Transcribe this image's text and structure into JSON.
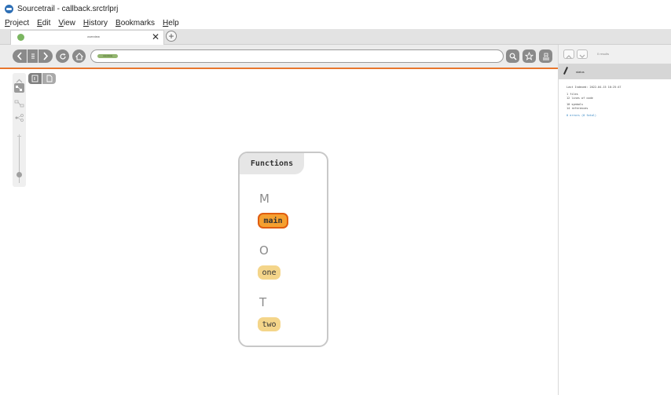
{
  "window": {
    "title": "Sourcetrail - callback.srctrlprj"
  },
  "menu": [
    {
      "accel": "P",
      "rest": "roject"
    },
    {
      "accel": "E",
      "rest": "dit"
    },
    {
      "accel": "V",
      "rest": "iew"
    },
    {
      "accel": "H",
      "rest": "istory"
    },
    {
      "accel": "B",
      "rest": "ookmarks"
    },
    {
      "accel": "H",
      "rest": "elp"
    }
  ],
  "tab": {
    "label": "overview",
    "close": "✕",
    "add": "+"
  },
  "search": {
    "token": "overview"
  },
  "graph": {
    "title": "Functions",
    "groups": [
      {
        "letter": "M",
        "items": [
          "main"
        ]
      },
      {
        "letter": "O",
        "items": [
          "one"
        ]
      },
      {
        "letter": "T",
        "items": [
          "two"
        ]
      }
    ],
    "selected": "main"
  },
  "status": {
    "result_count": "0 results",
    "header": "status",
    "lines": [
      "Last Indexed: 2022-04-15 10:25:47",
      "1 files",
      "12 lines of code",
      "10 symbols",
      "14 references",
      "0 errors (0 fatal)"
    ]
  },
  "colors": {
    "accent": "#e8762d",
    "node_fill": "#f4d58a",
    "active_fill": "#f5a030",
    "active_border": "#e05d10",
    "button_gray": "#8a8a8a"
  },
  "icons": [
    "back-icon",
    "history-list-icon",
    "forward-icon",
    "refresh-icon",
    "home-icon",
    "search-icon",
    "bookmark-star-icon",
    "bookmarks-list-icon",
    "chevron-up-icon",
    "chevron-down-icon",
    "edit-icon"
  ]
}
